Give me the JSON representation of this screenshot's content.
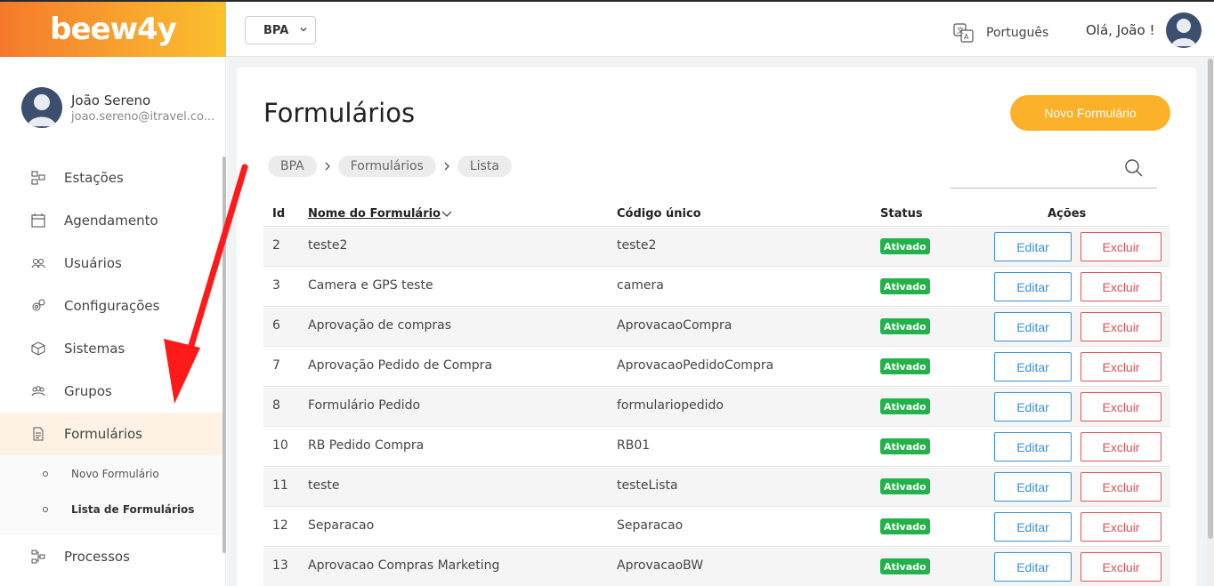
{
  "brand": {
    "logo_text": "beew4y"
  },
  "topbar": {
    "workspace_select": "BPA",
    "language": "Português",
    "greeting": "Olá, João !"
  },
  "sidebar": {
    "user": {
      "name": "João Sereno",
      "email": "joao.sereno@itravel.co..."
    },
    "items": [
      {
        "label": "Estações",
        "icon": "stations-icon"
      },
      {
        "label": "Agendamento",
        "icon": "calendar-icon"
      },
      {
        "label": "Usuários",
        "icon": "users-icon"
      },
      {
        "label": "Configurações",
        "icon": "gears-icon"
      },
      {
        "label": "Sistemas",
        "icon": "cube-icon"
      },
      {
        "label": "Grupos",
        "icon": "groups-icon"
      },
      {
        "label": "Formulários",
        "icon": "document-icon",
        "active": true
      },
      {
        "label": "Processos",
        "icon": "process-icon"
      }
    ],
    "subitems": [
      {
        "label": "Novo Formulário"
      },
      {
        "label": "Lista de Formulários",
        "active": true
      }
    ]
  },
  "main": {
    "title": "Formulários",
    "new_button": "Novo Formulário",
    "breadcrumbs": [
      "BPA",
      "Formulários",
      "Lista"
    ],
    "table": {
      "headers": {
        "id": "Id",
        "name": "Nome do Formulário",
        "code": "Código único",
        "status": "Status",
        "actions": "Ações"
      },
      "edit_label": "Editar",
      "delete_label": "Excluir",
      "rows": [
        {
          "id": "2",
          "name": "teste2",
          "code": "teste2",
          "status": "Ativado"
        },
        {
          "id": "3",
          "name": "Camera e GPS teste",
          "code": "camera",
          "status": "Ativado"
        },
        {
          "id": "6",
          "name": "Aprovação de compras",
          "code": "AprovacaoCompra",
          "status": "Ativado"
        },
        {
          "id": "7",
          "name": "Aprovação Pedido de Compra",
          "code": "AprovacaoPedidoCompra",
          "status": "Ativado"
        },
        {
          "id": "8",
          "name": "Formulário Pedido",
          "code": "formulariopedido",
          "status": "Ativado"
        },
        {
          "id": "10",
          "name": "RB Pedido Compra",
          "code": "RB01",
          "status": "Ativado"
        },
        {
          "id": "11",
          "name": "teste",
          "code": "testeLista",
          "status": "Ativado"
        },
        {
          "id": "12",
          "name": "Separacao",
          "code": "Separacao",
          "status": "Ativado"
        },
        {
          "id": "13",
          "name": "Aprovacao Compras Marketing",
          "code": "AprovacaoBW",
          "status": "Ativado"
        }
      ]
    }
  },
  "colors": {
    "accent": "#fbb12a",
    "status_active": "#21b34a",
    "edit": "#3b8fd6",
    "delete": "#e05050",
    "annotation_arrow": "#ff0000"
  }
}
